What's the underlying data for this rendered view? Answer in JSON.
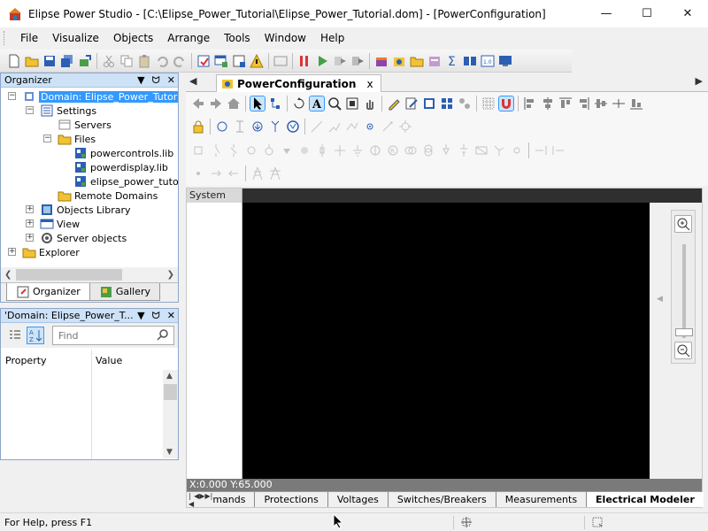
{
  "window": {
    "title": "Elipse Power Studio - [C:\\Elipse_Power_Tutorial\\Elipse_Power_Tutorial.dom] - [PowerConfiguration]",
    "minimize_glyph": "—",
    "maximize_glyph": "☐",
    "close_glyph": "✕"
  },
  "menu": {
    "items": [
      "File",
      "Visualize",
      "Objects",
      "Arrange",
      "Tools",
      "Window",
      "Help"
    ]
  },
  "organizer": {
    "title": "Organizer",
    "tree": [
      {
        "label": "Domain: Elipse_Power_Tutorial",
        "icon": "domain-icon",
        "selected": true
      },
      {
        "label": "Settings",
        "icon": "settings-icon"
      },
      {
        "label": "Servers",
        "icon": "servers-icon"
      },
      {
        "label": "Files",
        "icon": "folder-icon"
      },
      {
        "label": "powercontrols.lib",
        "icon": "library-icon"
      },
      {
        "label": "powerdisplay.lib",
        "icon": "library-icon"
      },
      {
        "label": "elipse_power_tutoria",
        "icon": "library-icon"
      },
      {
        "label": "Remote Domains",
        "icon": "folder-icon"
      },
      {
        "label": "Objects Library",
        "icon": "objects-library-icon"
      },
      {
        "label": "View",
        "icon": "view-icon"
      },
      {
        "label": "Server objects",
        "icon": "server-objects-icon"
      },
      {
        "label": "Explorer",
        "icon": "explorer-folder-icon"
      }
    ],
    "tabs": [
      "Organizer",
      "Gallery"
    ]
  },
  "properties": {
    "title": "'Domain: Elipse_Power_T...",
    "find_placeholder": "Find",
    "col_property": "Property",
    "col_value": "Value"
  },
  "document": {
    "tab_label": "PowerConfiguration",
    "close_glyph": "x"
  },
  "editor": {
    "system_label": "System",
    "coordinates": "X:0.000 Y:65.000",
    "bottom_tabs": [
      "mands",
      "Protections",
      "Voltages",
      "Switches/Breakers",
      "Measurements",
      "Electrical Modeler"
    ],
    "active_tab": "Electrical Modeler"
  },
  "status": {
    "help_text": "For Help, press F1"
  },
  "colors": {
    "panel_header": "#cde2f7",
    "selection": "#3399ff",
    "canvas": "#000000"
  }
}
